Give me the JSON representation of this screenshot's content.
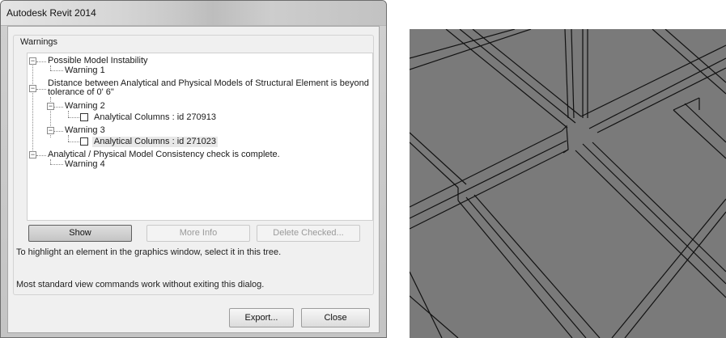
{
  "window": {
    "title": "Autodesk Revit 2014"
  },
  "group": {
    "label": "Warnings"
  },
  "tree": {
    "n1": {
      "label": "Possible Model Instability"
    },
    "n1_1": {
      "label": "Warning 1"
    },
    "n2": {
      "label_line1": "Distance between Analytical and Physical Models of Structural Element is beyond",
      "label_line2": "tolerance of 0'  6\""
    },
    "n2_1": {
      "label": "Warning 2"
    },
    "n2_1_1": {
      "label": "Analytical Columns : id 270913"
    },
    "n2_2": {
      "label": "Warning 3"
    },
    "n2_2_1": {
      "label": "Analytical Columns : id 271023"
    },
    "n3": {
      "label": "Analytical / Physical Model Consistency check is complete."
    },
    "n3_1": {
      "label": "Warning 4"
    }
  },
  "buttons": {
    "show": "Show",
    "more_info": "More Info",
    "delete_checked": "Delete Checked...",
    "export": "Export...",
    "close": "Close"
  },
  "hints": {
    "highlight": "To highlight an element in the graphics window, select it in this tree.",
    "view_commands": "Most standard view commands work without exiting this dialog."
  }
}
